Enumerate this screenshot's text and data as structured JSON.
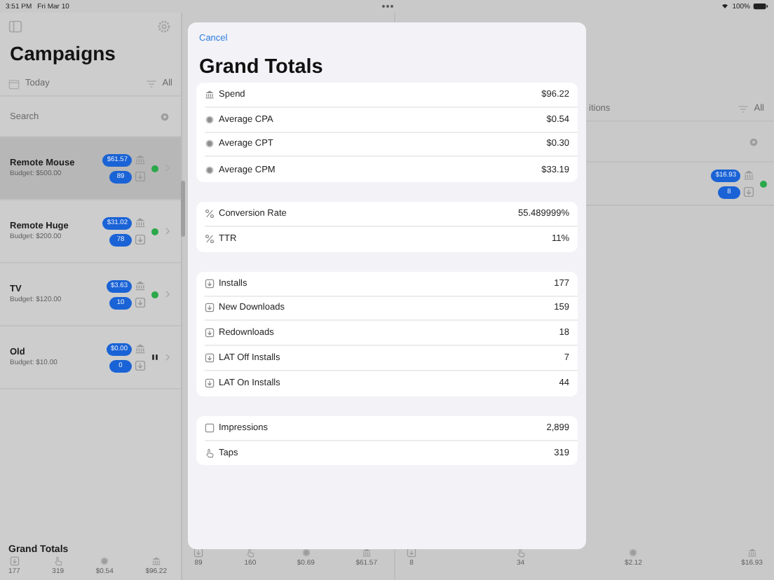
{
  "status_bar": {
    "time": "3:51 PM",
    "date": "Fri Mar 10",
    "battery": "100%"
  },
  "sidebar": {
    "title": "Campaigns",
    "date_filter": "Today",
    "filter": "All",
    "search": {
      "placeholder": "Search"
    },
    "campaigns": [
      {
        "name": "Remote Mouse",
        "budget": "Budget: $500.00",
        "spend": "$61.57",
        "installs": "89",
        "paused": false,
        "selected": true
      },
      {
        "name": "Remote Huge",
        "budget": "Budget: $200.00",
        "spend": "$31.02",
        "installs": "78",
        "paused": false,
        "selected": false
      },
      {
        "name": "TV",
        "budget": "Budget: $120.00",
        "spend": "$3.63",
        "installs": "10",
        "paused": false,
        "selected": false
      },
      {
        "name": "Old",
        "budget": "Budget: $10.00",
        "spend": "$0.00",
        "installs": "0",
        "paused": true,
        "selected": false
      }
    ],
    "totals": {
      "title": "Grand Totals",
      "items": [
        {
          "kind": "install",
          "value": "177"
        },
        {
          "kind": "tap",
          "value": "319"
        },
        {
          "kind": "cost",
          "value": "$0.54"
        },
        {
          "kind": "money",
          "value": "$96.22"
        }
      ]
    }
  },
  "detail": {
    "columns": [
      {
        "totals": [
          {
            "kind": "install",
            "value": "89"
          },
          {
            "kind": "tap",
            "value": "160"
          },
          {
            "kind": "cost",
            "value": "$0.69"
          },
          {
            "kind": "money",
            "value": "$61.57"
          }
        ]
      },
      {
        "header": "itions",
        "filter": "All",
        "rows": [
          {
            "spend": "$16.93",
            "installs": "8",
            "paused": false
          }
        ],
        "totals": [
          {
            "kind": "install",
            "value": "8"
          },
          {
            "kind": "tap",
            "value": "34"
          },
          {
            "kind": "cost",
            "value": "$2.12"
          },
          {
            "kind": "money",
            "value": "$16.93"
          }
        ]
      }
    ]
  },
  "sheet": {
    "cancel": "Cancel",
    "title": "Grand Totals",
    "sections": [
      {
        "rows": [
          {
            "kind": "money",
            "label": "Spend",
            "value": "$96.22"
          },
          {
            "kind": "cost",
            "label": "Average CPA",
            "value": "$0.54"
          },
          {
            "kind": "cost",
            "label": "Average CPT",
            "value": "$0.30"
          },
          {
            "kind": "cost",
            "label": "Average CPM",
            "value": "$33.19"
          }
        ]
      },
      {
        "rows": [
          {
            "kind": "ratio",
            "label": "Conversion Rate",
            "value": "55.489999%"
          },
          {
            "kind": "ratio",
            "label": "TTR",
            "value": "11%"
          }
        ]
      },
      {
        "rows": [
          {
            "kind": "install",
            "label": "Installs",
            "value": "177"
          },
          {
            "kind": "install",
            "label": "New Downloads",
            "value": "159"
          },
          {
            "kind": "install",
            "label": "Redownloads",
            "value": "18"
          },
          {
            "kind": "install",
            "label": "LAT Off Installs",
            "value": "7"
          },
          {
            "kind": "install",
            "label": "LAT On Installs",
            "value": "44"
          }
        ]
      },
      {
        "rows": [
          {
            "kind": "impression",
            "label": "Impressions",
            "value": "2,899"
          },
          {
            "kind": "tap",
            "label": "Taps",
            "value": "319"
          }
        ]
      }
    ]
  }
}
